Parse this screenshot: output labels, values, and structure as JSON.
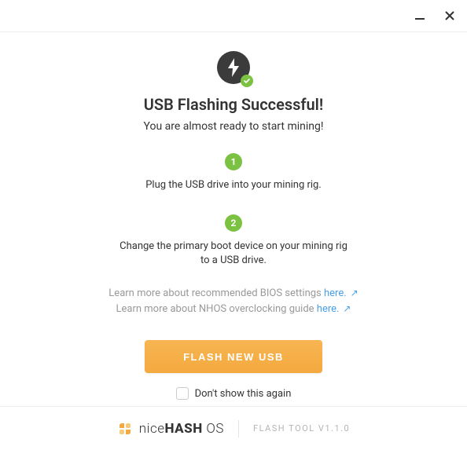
{
  "titlebar": {
    "minimize": "minimize-icon",
    "close": "close-icon"
  },
  "hero": {
    "icon": "lightning-icon",
    "badge": "check-icon"
  },
  "title": "USB Flashing Successful!",
  "subtitle": "You are almost ready to start mining!",
  "steps": [
    {
      "num": "1",
      "text": "Plug the USB drive into your mining rig."
    },
    {
      "num": "2",
      "text": "Change the primary boot device on your mining rig to a USB drive."
    }
  ],
  "learn": {
    "line1_pre": "Learn more about recommended BIOS settings ",
    "line1_link": "here.",
    "line2_pre": "Learn more about NHOS overclocking guide ",
    "line2_link": "here."
  },
  "cta": "FLASH NEW USB",
  "dontshow": "Don't show this again",
  "footer": {
    "brand_light": "nice",
    "brand_bold": "HASH",
    "brand_suffix": "OS",
    "tool": "FLASH TOOL V1.1.0"
  }
}
